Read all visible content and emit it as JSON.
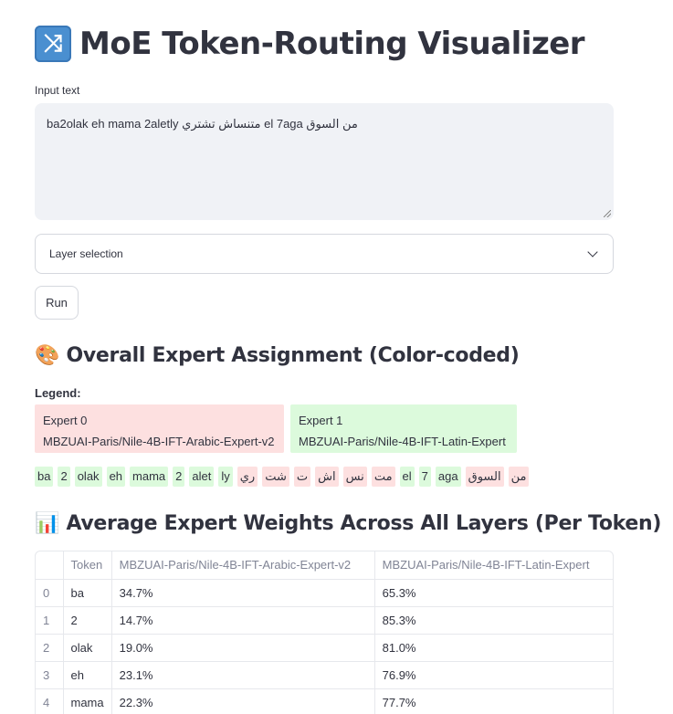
{
  "app": {
    "title": "MoE Token-Routing Visualizer",
    "title_icon": "shuffle-icon"
  },
  "input": {
    "label": "Input text",
    "value": "ba2olak eh mama 2aletly متنساش تشتري el 7aga من السوق"
  },
  "layer_select": {
    "placeholder": "Layer selection"
  },
  "run_button": {
    "label": "Run"
  },
  "assignment": {
    "icon": "🎨",
    "heading": "Overall Expert Assignment (Color-coded)",
    "legend_title": "Legend:",
    "legend": [
      {
        "name": "Expert 0",
        "model": "MBZUAI-Paris/Nile-4B-IFT-Arabic-Expert-v2",
        "color": "#fde0e0"
      },
      {
        "name": "Expert 1",
        "model": "MBZUAI-Paris/Nile-4B-IFT-Latin-Expert",
        "color": "#dcfadc"
      }
    ],
    "tokens": [
      {
        "text": "ba",
        "expert": 1
      },
      {
        "text": "2",
        "expert": 1
      },
      {
        "text": "olak",
        "expert": 1
      },
      {
        "text": "eh",
        "expert": 1
      },
      {
        "text": "mama",
        "expert": 1
      },
      {
        "text": "2",
        "expert": 1
      },
      {
        "text": "alet",
        "expert": 1
      },
      {
        "text": "ly",
        "expert": 1
      },
      {
        "text": "ري",
        "expert": 0
      },
      {
        "text": "شت",
        "expert": 0
      },
      {
        "text": "ت",
        "expert": 0
      },
      {
        "text": "اش",
        "expert": 0
      },
      {
        "text": "نس",
        "expert": 0
      },
      {
        "text": "مت",
        "expert": 0
      },
      {
        "text": "el",
        "expert": 1
      },
      {
        "text": "7",
        "expert": 1
      },
      {
        "text": "aga",
        "expert": 1
      },
      {
        "text": "السوق",
        "expert": 0
      },
      {
        "text": "من",
        "expert": 0
      }
    ]
  },
  "weights": {
    "icon": "📊",
    "heading": "Average Expert Weights Across All Layers (Per Token)",
    "columns": [
      "",
      "Token",
      "MBZUAI-Paris/Nile-4B-IFT-Arabic-Expert-v2",
      "MBZUAI-Paris/Nile-4B-IFT-Latin-Expert"
    ],
    "rows": [
      [
        "0",
        "ba",
        "34.7%",
        "65.3%"
      ],
      [
        "1",
        "2",
        "14.7%",
        "85.3%"
      ],
      [
        "2",
        "olak",
        "19.0%",
        "81.0%"
      ],
      [
        "3",
        "eh",
        "23.1%",
        "76.9%"
      ],
      [
        "4",
        "mama",
        "22.3%",
        "77.7%"
      ]
    ]
  }
}
